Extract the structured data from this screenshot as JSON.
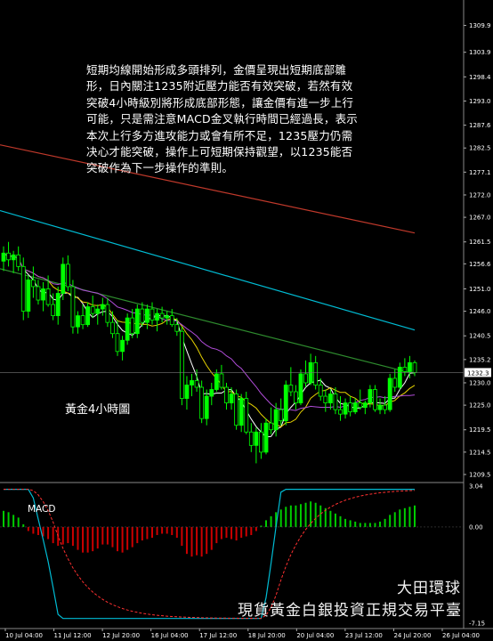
{
  "commentary": [
    "短期均線開始形成多頭排列，金價呈現出短期底部雛",
    "形，日內關注1235附近壓力能否有效突破，若然有效",
    "突破4小時級別將形成底部形態，讓金價有進一步上行",
    "可能，只是需注意MACD金叉執行時間已經過長，表示",
    "本次上行多方進攻能力或會有所不足，1235壓力仍需",
    "决心才能突破，操作上可短期保持觀望，以1235能否",
    "突破作為下一步操作的準則。"
  ],
  "chart_label": "黃金4小時圖",
  "macd_label": "MACD",
  "brand": "大田環球",
  "slogan": "現貨黃金白銀投資正規交易平臺",
  "colors": {
    "background": "#000000",
    "bull": "#00ff00",
    "bear": "#00ff00",
    "ma_fast": "#ffffff",
    "ma_yellow": "#e6d200",
    "ma_purple": "#b04cd8",
    "ma_green": "#2e8b2e",
    "ma_cyan": "#00bcd4",
    "ma_red": "#c0392b",
    "macd_hist": "#00cc00",
    "macd_hist_neg": "#cc0000",
    "macd_line": "#00bcd4",
    "signal_line": "#ff3030",
    "grid": "#333333"
  },
  "chart_data": {
    "type": "candlestick",
    "instrument": "Gold",
    "timeframe": "4H",
    "price_axis": {
      "ticks": [
        "1309.9",
        "1303.9",
        "1298.4",
        "1293.0",
        "1287.6",
        "1282.5",
        "1277.1",
        "1272.0",
        "1267.0",
        "1261.5",
        "1256.6",
        "1251.0",
        "1246.0",
        "1240.5",
        "1235.2",
        "1230.0",
        "1225.0",
        "1219.5",
        "1214.5",
        "1209.5"
      ],
      "ymin": 1208.5,
      "ymax": 1312.0,
      "current_price": "1232.3"
    },
    "macd_axis": {
      "ticks": [
        "3.04",
        "0.00",
        "-7.15"
      ],
      "ymin": -7.15,
      "ymax": 3.04
    },
    "time_labels": [
      "10 Jul 04:00",
      "11 Jul 12:00",
      "12 Jul 20:00",
      "16 Jul 04:00",
      "17 Jul 12:00",
      "18 Jul 20:00",
      "20 Jul 04:00",
      "23 Jul 12:00",
      "24 Jul 20:00",
      "26 Jul 04:00"
    ],
    "candles": [
      [
        1257.2,
        1260.5,
        1255.0,
        1259.0
      ],
      [
        1259.0,
        1261.5,
        1256.0,
        1257.5
      ],
      [
        1257.5,
        1259.5,
        1254.5,
        1258.6
      ],
      [
        1258.6,
        1260.5,
        1255.0,
        1256.0
      ],
      [
        1256.0,
        1258.0,
        1244.0,
        1246.0
      ],
      [
        1246.0,
        1254.0,
        1244.5,
        1253.0
      ],
      [
        1253.0,
        1256.0,
        1249.0,
        1251.5
      ],
      [
        1251.5,
        1253.0,
        1247.5,
        1248.5
      ],
      [
        1248.5,
        1252.5,
        1246.0,
        1251.0
      ],
      [
        1251.0,
        1254.0,
        1247.0,
        1247.5
      ],
      [
        1247.5,
        1250.0,
        1244.0,
        1245.0
      ],
      [
        1245.0,
        1251.5,
        1243.0,
        1250.0
      ],
      [
        1250.0,
        1258.0,
        1248.5,
        1256.5
      ],
      [
        1256.5,
        1258.5,
        1250.5,
        1251.5
      ],
      [
        1251.5,
        1253.0,
        1241.0,
        1242.5
      ],
      [
        1242.5,
        1246.0,
        1241.0,
        1245.0
      ],
      [
        1245.0,
        1247.5,
        1242.0,
        1243.0
      ],
      [
        1243.0,
        1248.0,
        1242.5,
        1247.0
      ],
      [
        1247.0,
        1249.5,
        1244.5,
        1245.5
      ],
      [
        1245.5,
        1247.5,
        1243.0,
        1246.5
      ],
      [
        1246.5,
        1249.0,
        1245.0,
        1247.5
      ],
      [
        1247.5,
        1249.0,
        1242.5,
        1243.5
      ],
      [
        1243.5,
        1246.0,
        1240.0,
        1241.0
      ],
      [
        1241.0,
        1244.0,
        1236.0,
        1237.0
      ],
      [
        1237.0,
        1240.5,
        1235.0,
        1239.5
      ],
      [
        1239.5,
        1245.5,
        1238.5,
        1244.5
      ],
      [
        1244.5,
        1246.5,
        1240.0,
        1241.0
      ],
      [
        1241.0,
        1247.5,
        1240.0,
        1246.5
      ],
      [
        1246.5,
        1248.0,
        1242.5,
        1243.5
      ],
      [
        1243.5,
        1247.5,
        1242.0,
        1246.5
      ],
      [
        1246.5,
        1248.0,
        1243.0,
        1244.0
      ],
      [
        1244.0,
        1246.5,
        1241.5,
        1245.5
      ],
      [
        1245.5,
        1247.0,
        1243.5,
        1244.5
      ],
      [
        1244.5,
        1246.0,
        1243.0,
        1245.0
      ],
      [
        1245.0,
        1246.5,
        1242.5,
        1243.0
      ],
      [
        1243.0,
        1244.5,
        1240.5,
        1241.5
      ],
      [
        1241.5,
        1242.5,
        1225.0,
        1226.5
      ],
      [
        1226.5,
        1231.5,
        1224.0,
        1229.5
      ],
      [
        1229.5,
        1232.0,
        1227.0,
        1230.5
      ],
      [
        1230.5,
        1233.0,
        1228.0,
        1229.0
      ],
      [
        1229.0,
        1230.5,
        1221.0,
        1222.0
      ],
      [
        1222.0,
        1228.5,
        1220.5,
        1227.0
      ],
      [
        1227.0,
        1230.0,
        1225.0,
        1228.5
      ],
      [
        1228.5,
        1233.0,
        1228.0,
        1232.0
      ],
      [
        1232.0,
        1234.0,
        1228.5,
        1229.0
      ],
      [
        1229.0,
        1230.0,
        1224.0,
        1225.5
      ],
      [
        1225.5,
        1229.0,
        1224.0,
        1227.5
      ],
      [
        1227.5,
        1228.5,
        1219.5,
        1220.5
      ],
      [
        1220.5,
        1227.5,
        1219.0,
        1226.5
      ],
      [
        1226.5,
        1228.0,
        1218.5,
        1219.0
      ],
      [
        1219.0,
        1221.0,
        1214.5,
        1216.0
      ],
      [
        1216.0,
        1220.0,
        1212.0,
        1219.0
      ],
      [
        1219.0,
        1221.0,
        1213.0,
        1214.5
      ],
      [
        1214.5,
        1222.0,
        1214.0,
        1221.0
      ],
      [
        1221.0,
        1224.5,
        1218.5,
        1219.5
      ],
      [
        1219.5,
        1225.5,
        1218.0,
        1224.0
      ],
      [
        1224.0,
        1226.5,
        1220.5,
        1221.5
      ],
      [
        1221.5,
        1230.5,
        1220.5,
        1229.5
      ],
      [
        1229.5,
        1233.5,
        1227.0,
        1228.0
      ],
      [
        1228.0,
        1229.5,
        1224.0,
        1225.5
      ],
      [
        1225.5,
        1233.0,
        1225.0,
        1232.0
      ],
      [
        1232.0,
        1235.0,
        1229.0,
        1230.0
      ],
      [
        1230.0,
        1236.5,
        1229.5,
        1234.5
      ],
      [
        1234.5,
        1236.0,
        1228.5,
        1229.5
      ],
      [
        1229.5,
        1231.0,
        1226.0,
        1227.0
      ],
      [
        1227.0,
        1228.5,
        1223.5,
        1225.5
      ],
      [
        1225.5,
        1228.5,
        1224.0,
        1227.5
      ],
      [
        1227.5,
        1229.0,
        1223.0,
        1224.0
      ],
      [
        1224.0,
        1227.0,
        1221.5,
        1223.0
      ],
      [
        1223.0,
        1226.5,
        1222.0,
        1225.5
      ],
      [
        1225.5,
        1227.0,
        1222.5,
        1223.5
      ],
      [
        1223.5,
        1226.5,
        1223.0,
        1225.5
      ],
      [
        1225.5,
        1228.5,
        1224.0,
        1224.5
      ],
      [
        1224.5,
        1226.0,
        1223.0,
        1225.5
      ],
      [
        1225.5,
        1229.5,
        1224.5,
        1228.5
      ],
      [
        1228.5,
        1229.5,
        1223.5,
        1224.0
      ],
      [
        1224.0,
        1226.5,
        1223.0,
        1225.0
      ],
      [
        1225.0,
        1227.0,
        1223.0,
        1224.0
      ],
      [
        1224.0,
        1232.0,
        1223.5,
        1231.0
      ],
      [
        1231.0,
        1233.0,
        1228.0,
        1229.0
      ],
      [
        1229.0,
        1234.5,
        1228.5,
        1233.5
      ],
      [
        1233.5,
        1235.5,
        1231.5,
        1232.5
      ],
      [
        1232.5,
        1236.0,
        1231.0,
        1234.5
      ],
      [
        1234.5,
        1235.0,
        1231.5,
        1232.3
      ]
    ],
    "ma_lines": [
      {
        "color_key": "ma_red",
        "y_start": 1283.2,
        "y_end": 1263.5
      },
      {
        "color_key": "ma_cyan",
        "y_start": 1268.5,
        "y_end": 1241.8
      },
      {
        "color_key": "ma_green",
        "y_start": 1255.5,
        "y_end": 1232.0
      }
    ],
    "macd": {
      "histogram": [
        1.2,
        1.1,
        0.9,
        0.7,
        0.2,
        -0.3,
        -0.5,
        -0.6,
        -0.7,
        -0.9,
        -1.2,
        -1.4,
        -1.3,
        -1.2,
        -1.4,
        -1.7,
        -1.9,
        -1.9,
        -1.8,
        -1.6,
        -1.3,
        -1.3,
        -1.5,
        -1.8,
        -1.9,
        -1.7,
        -1.5,
        -1.2,
        -1.0,
        -0.9,
        -0.8,
        -0.6,
        -0.5,
        -0.5,
        -0.6,
        -0.8,
        -1.4,
        -2.0,
        -2.2,
        -2.1,
        -2.2,
        -2.0,
        -1.7,
        -1.2,
        -0.9,
        -0.8,
        -0.9,
        -1.0,
        -0.8,
        -0.7,
        -0.6,
        -0.3,
        0.1,
        0.5,
        0.8,
        1.1,
        1.3,
        1.5,
        1.6,
        1.6,
        1.7,
        1.8,
        1.9,
        1.8,
        1.6,
        1.4,
        1.2,
        1.0,
        0.8,
        0.6,
        0.5,
        0.4,
        0.3,
        0.3,
        0.3,
        0.3,
        0.4,
        0.6,
        0.9,
        1.1,
        1.3,
        1.4,
        1.5,
        1.6
      ],
      "macd_line_start": 1.0,
      "macd_line_end": 1.9
    }
  }
}
